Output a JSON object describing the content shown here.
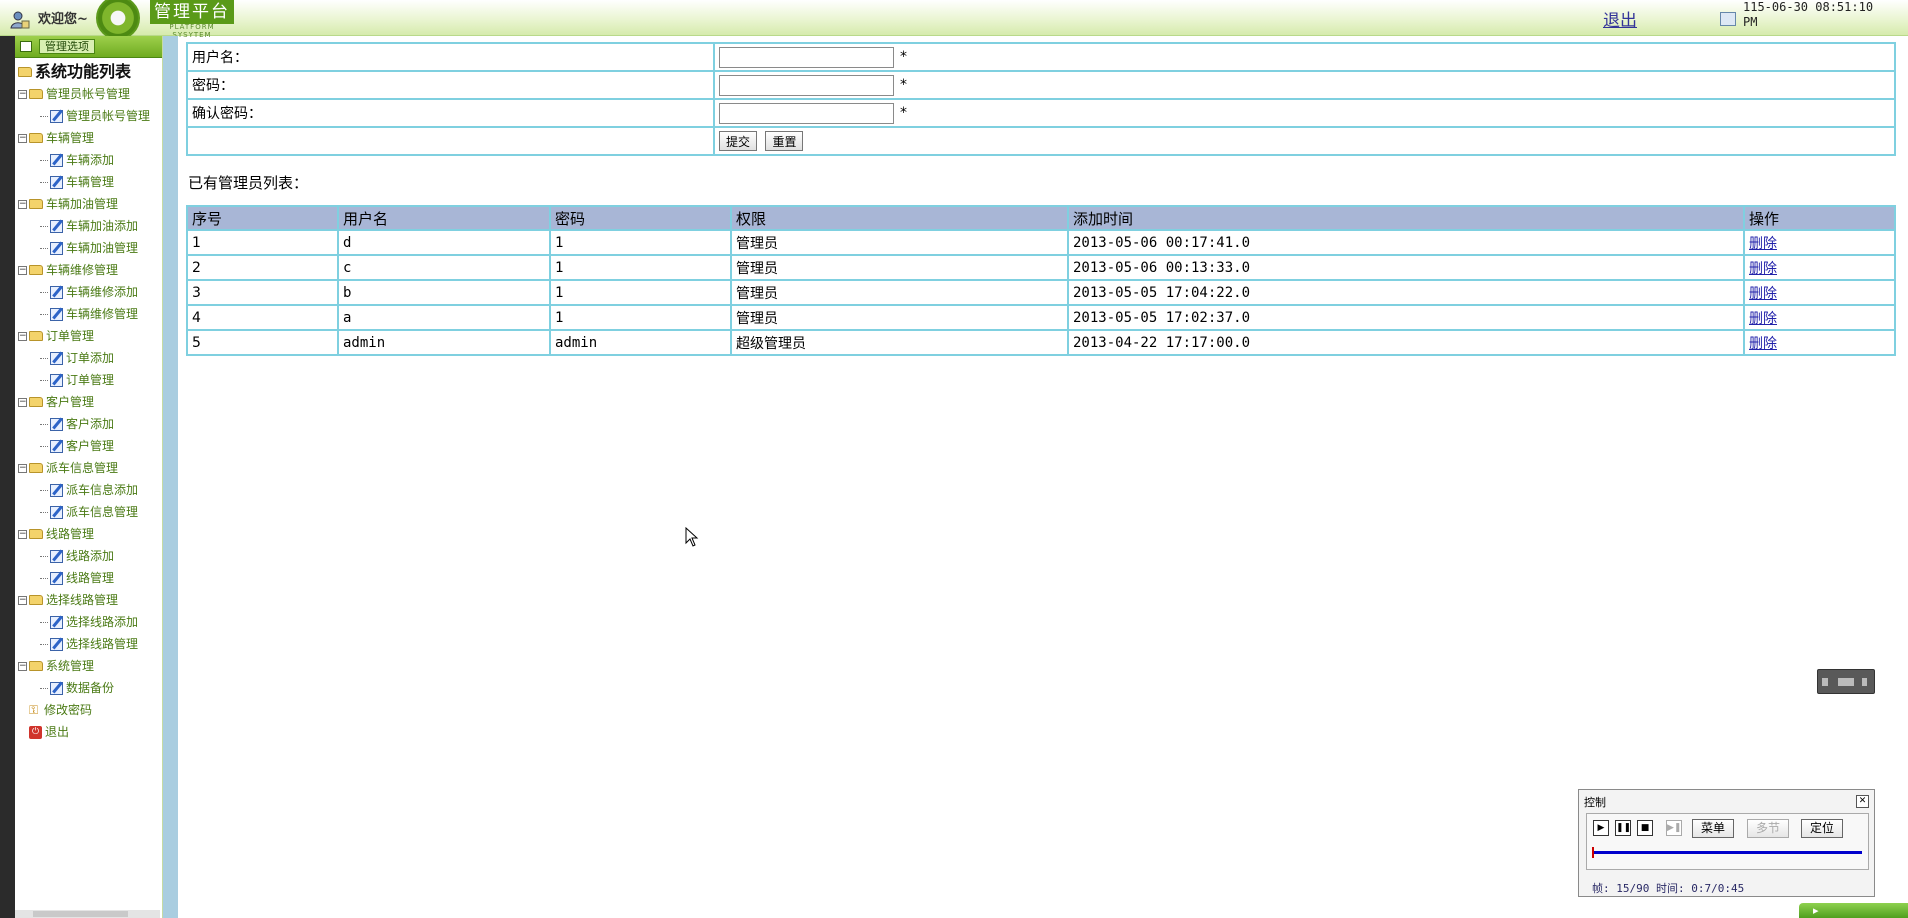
{
  "header": {
    "welcome": "欢迎您~",
    "logo_title": "管理平台",
    "logo_sub": "PLATFORM SYSYTEM",
    "logout": "退出",
    "datetime": "115-06-30 08:51:10 PM"
  },
  "sidebar": {
    "title": "管理选项",
    "root": "系统功能列表",
    "groups": [
      {
        "label": "管理员帐号管理",
        "children": [
          "管理员帐号管理"
        ]
      },
      {
        "label": "车辆管理",
        "children": [
          "车辆添加",
          "车辆管理"
        ]
      },
      {
        "label": "车辆加油管理",
        "children": [
          "车辆加油添加",
          "车辆加油管理"
        ]
      },
      {
        "label": "车辆维修管理",
        "children": [
          "车辆维修添加",
          "车辆维修管理"
        ]
      },
      {
        "label": "订单管理",
        "children": [
          "订单添加",
          "订单管理"
        ]
      },
      {
        "label": "客户管理",
        "children": [
          "客户添加",
          "客户管理"
        ]
      },
      {
        "label": "派车信息管理",
        "children": [
          "派车信息添加",
          "派车信息管理"
        ]
      },
      {
        "label": "线路管理",
        "children": [
          "线路添加",
          "线路管理"
        ]
      },
      {
        "label": "选择线路管理",
        "children": [
          "选择线路添加",
          "选择线路管理"
        ]
      },
      {
        "label": "系统管理",
        "children": [
          "数据备份"
        ]
      }
    ],
    "change_password": "修改密码",
    "logout": "退出"
  },
  "form": {
    "username_label": "用户名：",
    "password_label": "密码：",
    "confirm_label": "确认密码：",
    "required_mark": "*",
    "username_value": "",
    "password_value": "",
    "confirm_value": "",
    "submit": "提交",
    "reset": "重置"
  },
  "list": {
    "caption": "已有管理员列表：",
    "columns": [
      "序号",
      "用户名",
      "密码",
      "权限",
      "添加时间",
      "操作"
    ],
    "rows": [
      {
        "id": "1",
        "username": "d",
        "password": "1",
        "role": "管理员",
        "time": "2013-05-06 00:17:41.0",
        "action": "删除"
      },
      {
        "id": "2",
        "username": "c",
        "password": "1",
        "role": "管理员",
        "time": "2013-05-06 00:13:33.0",
        "action": "删除"
      },
      {
        "id": "3",
        "username": "b",
        "password": "1",
        "role": "管理员",
        "time": "2013-05-05 17:04:22.0",
        "action": "删除"
      },
      {
        "id": "4",
        "username": "a",
        "password": "1",
        "role": "管理员",
        "time": "2013-05-05 17:02:37.0",
        "action": "删除"
      },
      {
        "id": "5",
        "username": "admin",
        "password": "admin",
        "role": "超级管理员",
        "time": "2013-04-22 17:17:00.0",
        "action": "删除"
      }
    ]
  },
  "control": {
    "title": "控制",
    "menu": "菜单",
    "multi": "多节",
    "locate": "定位",
    "frame_info": "帧: 15/90 时间: 0:7/0:45",
    "progress": 0.167
  },
  "colors": {
    "header_green": "#d6ebac",
    "table_border": "#7fd0e0",
    "table_header": "#a8b6d6",
    "link": "#2222aa"
  }
}
